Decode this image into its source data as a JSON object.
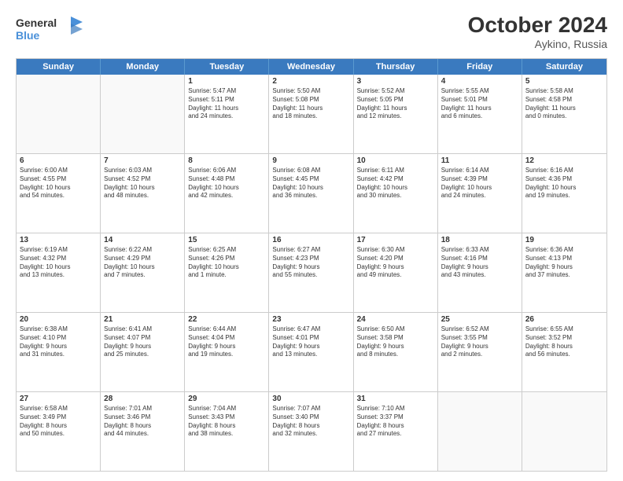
{
  "header": {
    "logo_line1": "General",
    "logo_line2": "Blue",
    "month_year": "October 2024",
    "location": "Aykino, Russia"
  },
  "weekdays": [
    "Sunday",
    "Monday",
    "Tuesday",
    "Wednesday",
    "Thursday",
    "Friday",
    "Saturday"
  ],
  "rows": [
    [
      {
        "day": "",
        "text": "",
        "empty": true
      },
      {
        "day": "",
        "text": "",
        "empty": true
      },
      {
        "day": "1",
        "text": "Sunrise: 5:47 AM\nSunset: 5:11 PM\nDaylight: 11 hours\nand 24 minutes."
      },
      {
        "day": "2",
        "text": "Sunrise: 5:50 AM\nSunset: 5:08 PM\nDaylight: 11 hours\nand 18 minutes."
      },
      {
        "day": "3",
        "text": "Sunrise: 5:52 AM\nSunset: 5:05 PM\nDaylight: 11 hours\nand 12 minutes."
      },
      {
        "day": "4",
        "text": "Sunrise: 5:55 AM\nSunset: 5:01 PM\nDaylight: 11 hours\nand 6 minutes."
      },
      {
        "day": "5",
        "text": "Sunrise: 5:58 AM\nSunset: 4:58 PM\nDaylight: 11 hours\nand 0 minutes."
      }
    ],
    [
      {
        "day": "6",
        "text": "Sunrise: 6:00 AM\nSunset: 4:55 PM\nDaylight: 10 hours\nand 54 minutes."
      },
      {
        "day": "7",
        "text": "Sunrise: 6:03 AM\nSunset: 4:52 PM\nDaylight: 10 hours\nand 48 minutes."
      },
      {
        "day": "8",
        "text": "Sunrise: 6:06 AM\nSunset: 4:48 PM\nDaylight: 10 hours\nand 42 minutes."
      },
      {
        "day": "9",
        "text": "Sunrise: 6:08 AM\nSunset: 4:45 PM\nDaylight: 10 hours\nand 36 minutes."
      },
      {
        "day": "10",
        "text": "Sunrise: 6:11 AM\nSunset: 4:42 PM\nDaylight: 10 hours\nand 30 minutes."
      },
      {
        "day": "11",
        "text": "Sunrise: 6:14 AM\nSunset: 4:39 PM\nDaylight: 10 hours\nand 24 minutes."
      },
      {
        "day": "12",
        "text": "Sunrise: 6:16 AM\nSunset: 4:36 PM\nDaylight: 10 hours\nand 19 minutes."
      }
    ],
    [
      {
        "day": "13",
        "text": "Sunrise: 6:19 AM\nSunset: 4:32 PM\nDaylight: 10 hours\nand 13 minutes."
      },
      {
        "day": "14",
        "text": "Sunrise: 6:22 AM\nSunset: 4:29 PM\nDaylight: 10 hours\nand 7 minutes."
      },
      {
        "day": "15",
        "text": "Sunrise: 6:25 AM\nSunset: 4:26 PM\nDaylight: 10 hours\nand 1 minute."
      },
      {
        "day": "16",
        "text": "Sunrise: 6:27 AM\nSunset: 4:23 PM\nDaylight: 9 hours\nand 55 minutes."
      },
      {
        "day": "17",
        "text": "Sunrise: 6:30 AM\nSunset: 4:20 PM\nDaylight: 9 hours\nand 49 minutes."
      },
      {
        "day": "18",
        "text": "Sunrise: 6:33 AM\nSunset: 4:16 PM\nDaylight: 9 hours\nand 43 minutes."
      },
      {
        "day": "19",
        "text": "Sunrise: 6:36 AM\nSunset: 4:13 PM\nDaylight: 9 hours\nand 37 minutes."
      }
    ],
    [
      {
        "day": "20",
        "text": "Sunrise: 6:38 AM\nSunset: 4:10 PM\nDaylight: 9 hours\nand 31 minutes."
      },
      {
        "day": "21",
        "text": "Sunrise: 6:41 AM\nSunset: 4:07 PM\nDaylight: 9 hours\nand 25 minutes."
      },
      {
        "day": "22",
        "text": "Sunrise: 6:44 AM\nSunset: 4:04 PM\nDaylight: 9 hours\nand 19 minutes."
      },
      {
        "day": "23",
        "text": "Sunrise: 6:47 AM\nSunset: 4:01 PM\nDaylight: 9 hours\nand 13 minutes."
      },
      {
        "day": "24",
        "text": "Sunrise: 6:50 AM\nSunset: 3:58 PM\nDaylight: 9 hours\nand 8 minutes."
      },
      {
        "day": "25",
        "text": "Sunrise: 6:52 AM\nSunset: 3:55 PM\nDaylight: 9 hours\nand 2 minutes."
      },
      {
        "day": "26",
        "text": "Sunrise: 6:55 AM\nSunset: 3:52 PM\nDaylight: 8 hours\nand 56 minutes."
      }
    ],
    [
      {
        "day": "27",
        "text": "Sunrise: 6:58 AM\nSunset: 3:49 PM\nDaylight: 8 hours\nand 50 minutes."
      },
      {
        "day": "28",
        "text": "Sunrise: 7:01 AM\nSunset: 3:46 PM\nDaylight: 8 hours\nand 44 minutes."
      },
      {
        "day": "29",
        "text": "Sunrise: 7:04 AM\nSunset: 3:43 PM\nDaylight: 8 hours\nand 38 minutes."
      },
      {
        "day": "30",
        "text": "Sunrise: 7:07 AM\nSunset: 3:40 PM\nDaylight: 8 hours\nand 32 minutes."
      },
      {
        "day": "31",
        "text": "Sunrise: 7:10 AM\nSunset: 3:37 PM\nDaylight: 8 hours\nand 27 minutes."
      },
      {
        "day": "",
        "text": "",
        "empty": true
      },
      {
        "day": "",
        "text": "",
        "empty": true
      }
    ]
  ]
}
